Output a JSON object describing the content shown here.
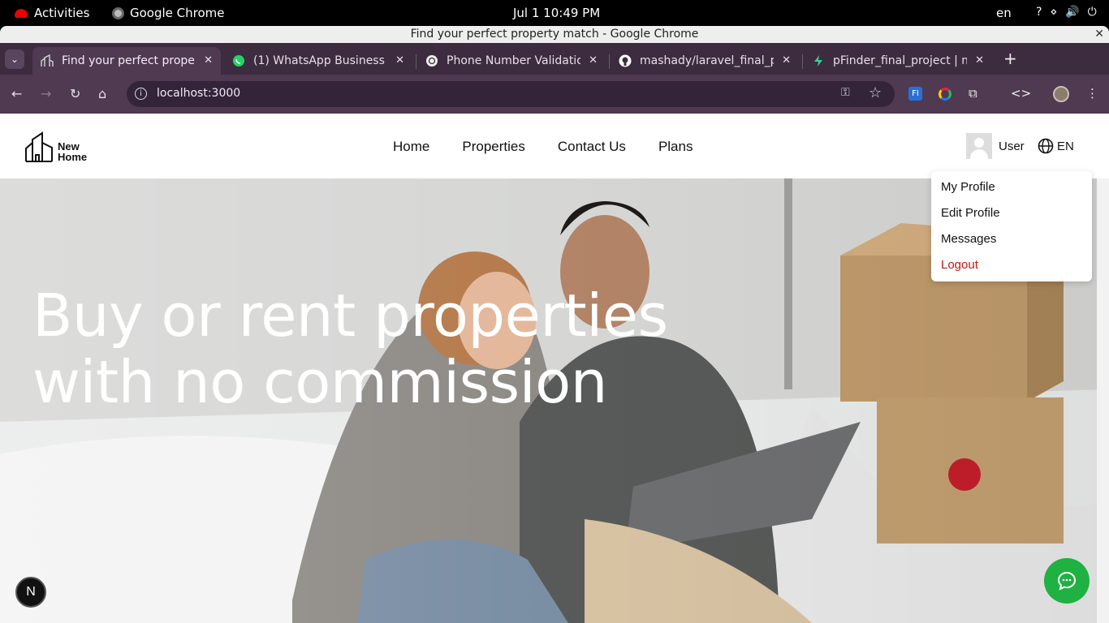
{
  "system": {
    "activities": "Activities",
    "app_name": "Google Chrome",
    "clock": "Jul 1  10:49 PM",
    "lang": "en"
  },
  "window": {
    "title": "Find your perfect property match - Google Chrome"
  },
  "tabs": [
    {
      "title": "Find your perfect property match",
      "active": true
    },
    {
      "title": "(1) WhatsApp Business"
    },
    {
      "title": "Phone Number Validation"
    },
    {
      "title": "mashady/laravel_final_project"
    },
    {
      "title": "pFinder_final_project | m"
    }
  ],
  "address_bar": {
    "url": "localhost:3000"
  },
  "site": {
    "logo": {
      "line1": "New",
      "line2": "Home"
    },
    "nav": [
      "Home",
      "Properties",
      "Contact Us",
      "Plans"
    ],
    "user_label": "User",
    "lang_label": "EN",
    "hero_title_line1": "Buy or rent properties",
    "hero_title_line2": "with no commission",
    "user_menu": [
      "My Profile",
      "Edit Profile",
      "Messages",
      "Logout"
    ]
  },
  "colors": {
    "accent": "#1fb141",
    "logout": "#c21515",
    "chrome_tabstrip": "#3d2b3f",
    "chrome_toolbar": "#4f3a52"
  }
}
